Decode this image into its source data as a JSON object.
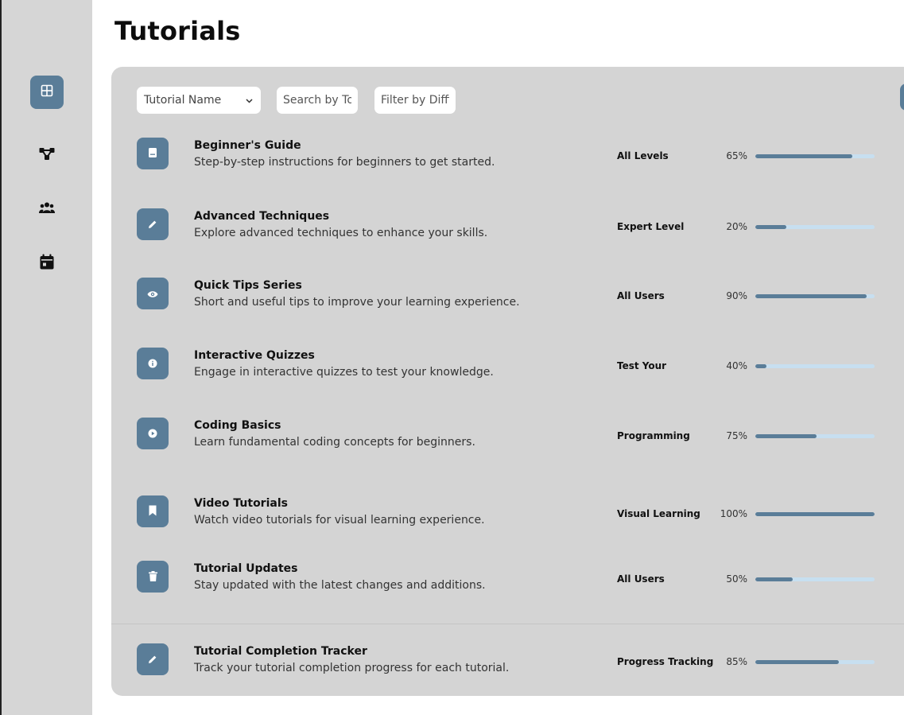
{
  "page": {
    "title": "Tutorials"
  },
  "sidebar": {
    "items": [
      {
        "icon": "dashboard-grid-icon",
        "active": true
      },
      {
        "icon": "network-nodes-icon",
        "active": false
      },
      {
        "icon": "users-group-icon",
        "active": false
      },
      {
        "icon": "calendar-icon",
        "active": false
      }
    ]
  },
  "filters": {
    "sort_select": {
      "value": "Tutorial Name"
    },
    "topic_search": {
      "placeholder": "Search by Topic"
    },
    "difficulty_filter": {
      "placeholder": "Filter by Difficulty"
    }
  },
  "colors": {
    "accent": "#5a7d98",
    "panel": "#d4d4d4",
    "sidebar": "#d6d6d6",
    "track": "#c7dff0"
  },
  "tutorials": [
    {
      "icon": "book-icon",
      "title": "Beginner's Guide",
      "description": "Step-by-step instructions for beginners to get started.",
      "level": "All Levels",
      "progress_label": "65%",
      "progress_fill": 0.81
    },
    {
      "icon": "pencil-icon",
      "title": "Advanced Techniques",
      "description": "Explore advanced techniques to enhance your skills.",
      "level": "Expert Level",
      "progress_label": "20%",
      "progress_fill": 0.26
    },
    {
      "icon": "eye-icon",
      "title": "Quick Tips Series",
      "description": "Short and useful tips to improve your learning experience.",
      "level": "All Users",
      "progress_label": "90%",
      "progress_fill": 0.93
    },
    {
      "icon": "info-icon",
      "title": "Interactive Quizzes",
      "description": "Engage in interactive quizzes to test your knowledge.",
      "level": "Test Your",
      "progress_label": "40%",
      "progress_fill": 0.09
    },
    {
      "icon": "play-icon",
      "title": "Coding Basics",
      "description": "Learn fundamental coding concepts for beginners.",
      "level": "Programming",
      "progress_label": "75%",
      "progress_fill": 0.51
    },
    {
      "icon": "bookmark-icon",
      "title": "Video Tutorials",
      "description": "Watch video tutorials for visual learning experience.",
      "level": "Visual Learning",
      "progress_label": "100%",
      "progress_fill": 1.0
    },
    {
      "icon": "trash-icon",
      "title": "Tutorial Updates",
      "description": "Stay updated with the latest changes and additions.",
      "level": "All Users",
      "progress_label": "50%",
      "progress_fill": 0.31
    },
    {
      "icon": "pencil-icon",
      "title": "Tutorial Completion Tracker",
      "description": "Track your tutorial completion progress for each tutorial.",
      "level": "Progress Tracking",
      "progress_label": "85%",
      "progress_fill": 0.7
    }
  ]
}
